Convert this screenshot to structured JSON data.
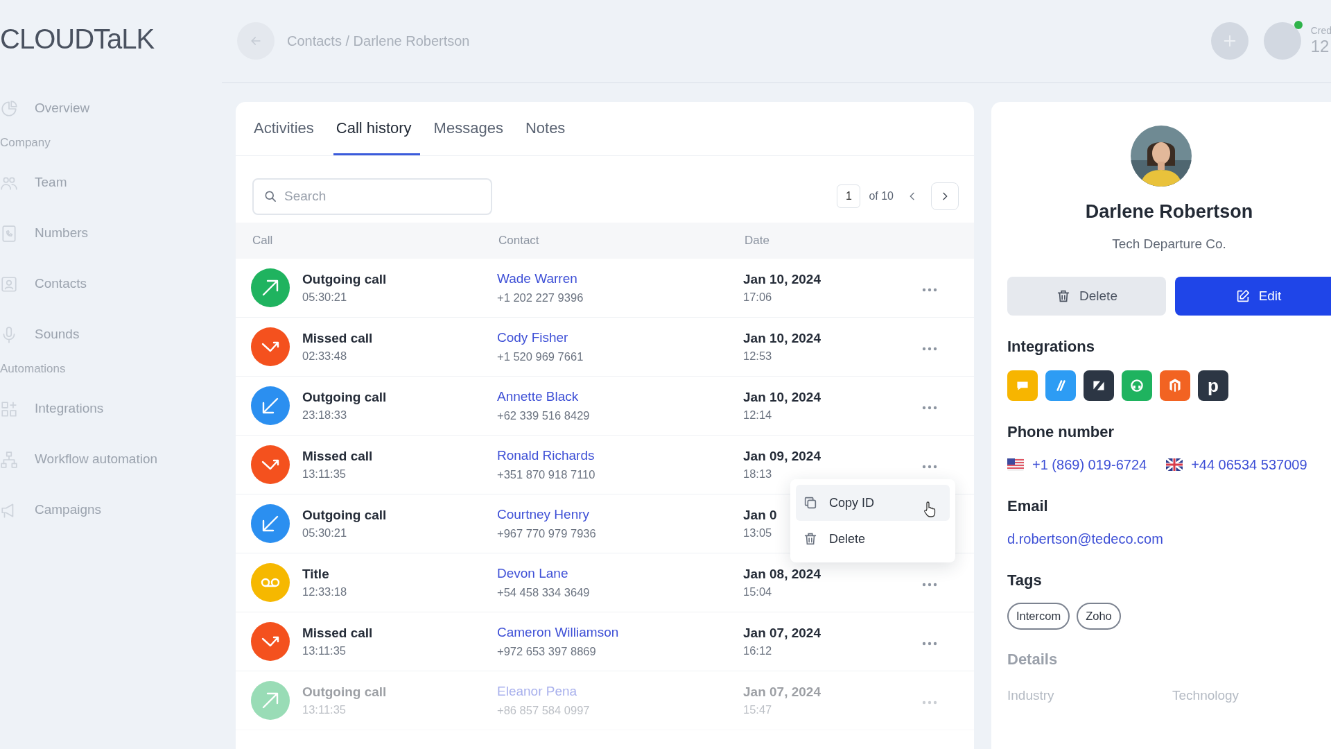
{
  "logo": "CLOUDTaLK",
  "sidebar": [
    {
      "kind": "link",
      "label": "Overview"
    },
    {
      "kind": "section",
      "label": "Company"
    },
    {
      "kind": "link",
      "label": "Team"
    },
    {
      "kind": "link",
      "label": "Numbers"
    },
    {
      "kind": "link",
      "label": "Contacts"
    },
    {
      "kind": "link",
      "label": "Sounds"
    },
    {
      "kind": "section",
      "label": "Automations"
    },
    {
      "kind": "link",
      "label": "Integrations"
    },
    {
      "kind": "link",
      "label": "Workflow automation"
    },
    {
      "kind": "link",
      "label": "Campaigns"
    }
  ],
  "header": {
    "breadcrumb": "Contacts / Darlene Robertson",
    "online": true,
    "credit_label": "Cred",
    "credit_value": "12"
  },
  "tabs": [
    {
      "label": "Activities",
      "selected": false
    },
    {
      "label": "Call history",
      "selected": true
    },
    {
      "label": "Messages",
      "selected": false
    },
    {
      "label": "Notes",
      "selected": false
    }
  ],
  "search": {
    "placeholder": "Search"
  },
  "pagination": {
    "page": "1",
    "of": "of 10"
  },
  "table": {
    "columns": [
      "Call",
      "Contact",
      "Date"
    ],
    "rows": [
      {
        "kind": "outgoing",
        "title": "Outgoing call",
        "duration": "05:30:21",
        "contact": "Wade Warren",
        "phone": "+1 202 227 9396",
        "date": "Jan 10, 2024",
        "time": "17:06"
      },
      {
        "kind": "missed",
        "title": "Missed call",
        "duration": "02:33:48",
        "contact": "Cody Fisher",
        "phone": "+1 520 969 7661",
        "date": "Jan 10, 2024",
        "time": "12:53"
      },
      {
        "kind": "incoming",
        "title": "Outgoing call",
        "duration": "23:18:33",
        "contact": "Annette Black",
        "phone": "+62 339 516 8429",
        "date": "Jan 10, 2024",
        "time": "12:14"
      },
      {
        "kind": "missed",
        "title": "Missed call",
        "duration": "13:11:35",
        "contact": "Ronald Richards",
        "phone": "+351 870 918 7110",
        "date": "Jan 09, 2024",
        "time": "18:13",
        "menu": [
          {
            "label": "Copy ID",
            "selected": true
          },
          {
            "label": "Delete",
            "selected": false
          }
        ]
      },
      {
        "kind": "incoming",
        "title": "Outgoing call",
        "duration": "05:30:21",
        "contact": "Courtney Henry",
        "phone": "+967 770 979 7936",
        "date": "Jan 0",
        "time": "13:05"
      },
      {
        "kind": "voicemail",
        "title": "Title",
        "duration": "12:33:18",
        "contact": "Devon Lane",
        "phone": "+54 458 334 3649",
        "date": "Jan 08, 2024",
        "time": "15:04"
      },
      {
        "kind": "missed",
        "title": "Missed call",
        "duration": "13:11:35",
        "contact": "Cameron Williamson",
        "phone": "+972 653 397 8869",
        "date": "Jan 07, 2024",
        "time": "16:12"
      },
      {
        "kind": "outgoing",
        "title": "Outgoing call",
        "duration": "13:11:35",
        "contact": "Eleanor Pena",
        "phone": "+86 857 584 0997",
        "date": "Jan 07, 2024",
        "time": "15:47"
      }
    ]
  },
  "contact": {
    "name": "Darlene Robertson",
    "company": "Tech Departure Co.",
    "buttons": [
      {
        "kind": "secondary",
        "label": "Delete"
      },
      {
        "kind": "primary",
        "label": "Edit"
      }
    ],
    "integrations_title": "Integrations",
    "integrations": [
      {
        "kind": "chat",
        "color": "#f7b500"
      },
      {
        "kind": "slashes",
        "color": "#2d9cf4"
      },
      {
        "kind": "zmark",
        "color": "#2c3644"
      },
      {
        "kind": "headset",
        "color": "#1fb35f"
      },
      {
        "kind": "mark",
        "color": "#f26322"
      },
      {
        "kind": "letter",
        "letter": "p",
        "color": "#2c3644"
      }
    ],
    "phone_title": "Phone number",
    "phones": [
      {
        "kind": "us",
        "number": "+1 (869) 019-6724"
      },
      {
        "kind": "gb",
        "number": "+44 06534 537009"
      }
    ],
    "email_title": "Email",
    "email": "d.robertson@tedeco.com",
    "tags_title": "Tags",
    "tags": [
      "Intercom",
      "Zoho"
    ],
    "details_title": "Details",
    "details": [
      {
        "label": "Industry",
        "value": "Technology"
      }
    ]
  }
}
